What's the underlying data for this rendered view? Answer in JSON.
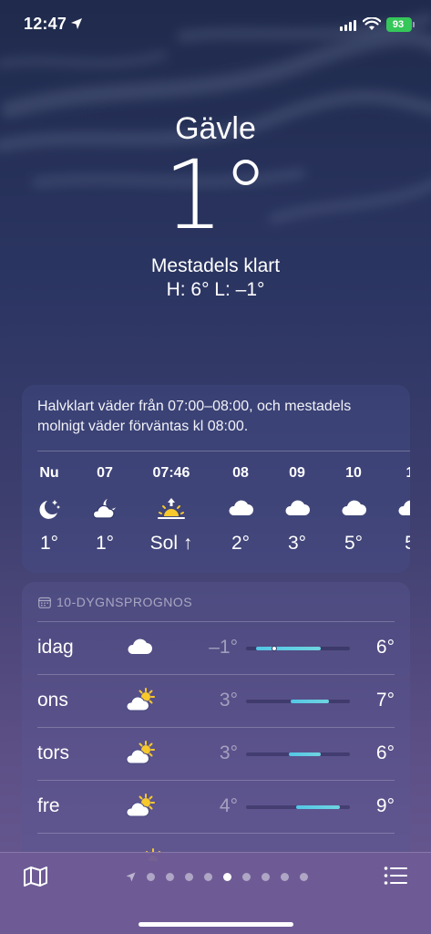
{
  "status_bar": {
    "time": "12:47",
    "battery": "93"
  },
  "location": {
    "city": "Gävle",
    "temperature": "1°",
    "condition": "Mestadels klart",
    "high_low": "H: 6°  L: –1°"
  },
  "hourly": {
    "summary": "Halvklart väder från 07:00–08:00, och mestadels molnigt väder förväntas kl 08:00.",
    "hours": [
      {
        "label": "Nu",
        "icon": "moon-stars-icon",
        "temp": "1°"
      },
      {
        "label": "07",
        "icon": "moon-cloud-icon",
        "temp": "1°"
      },
      {
        "label": "07:46",
        "icon": "sunrise-icon",
        "temp": "Sol ↑"
      },
      {
        "label": "08",
        "icon": "cloud-icon",
        "temp": "2°"
      },
      {
        "label": "09",
        "icon": "cloud-icon",
        "temp": "3°"
      },
      {
        "label": "10",
        "icon": "cloud-icon",
        "temp": "5°"
      },
      {
        "label": "1",
        "icon": "cloud-icon",
        "temp": "5"
      }
    ]
  },
  "daily": {
    "header": "10-DYGNSPROGNOS",
    "days": [
      {
        "name": "idag",
        "icon": "cloud-icon",
        "low": "–1°",
        "high": "6°",
        "range_start": 0.1,
        "range_end": 0.72,
        "current": 0.27
      },
      {
        "name": "ons",
        "icon": "partly-sunny-icon",
        "low": "3°",
        "high": "7°",
        "range_start": 0.43,
        "range_end": 0.8
      },
      {
        "name": "tors",
        "icon": "partly-sunny-icon",
        "low": "3°",
        "high": "6°",
        "range_start": 0.41,
        "range_end": 0.72
      },
      {
        "name": "fre",
        "icon": "partly-sunny-icon",
        "low": "4°",
        "high": "9°",
        "range_start": 0.48,
        "range_end": 0.9
      }
    ]
  },
  "bottom_bar": {
    "page_count": 9,
    "active_page": 5
  },
  "colors": {
    "accent_range": "#5ccbe3",
    "battery": "#35c759",
    "sun": "#f7c92c"
  }
}
